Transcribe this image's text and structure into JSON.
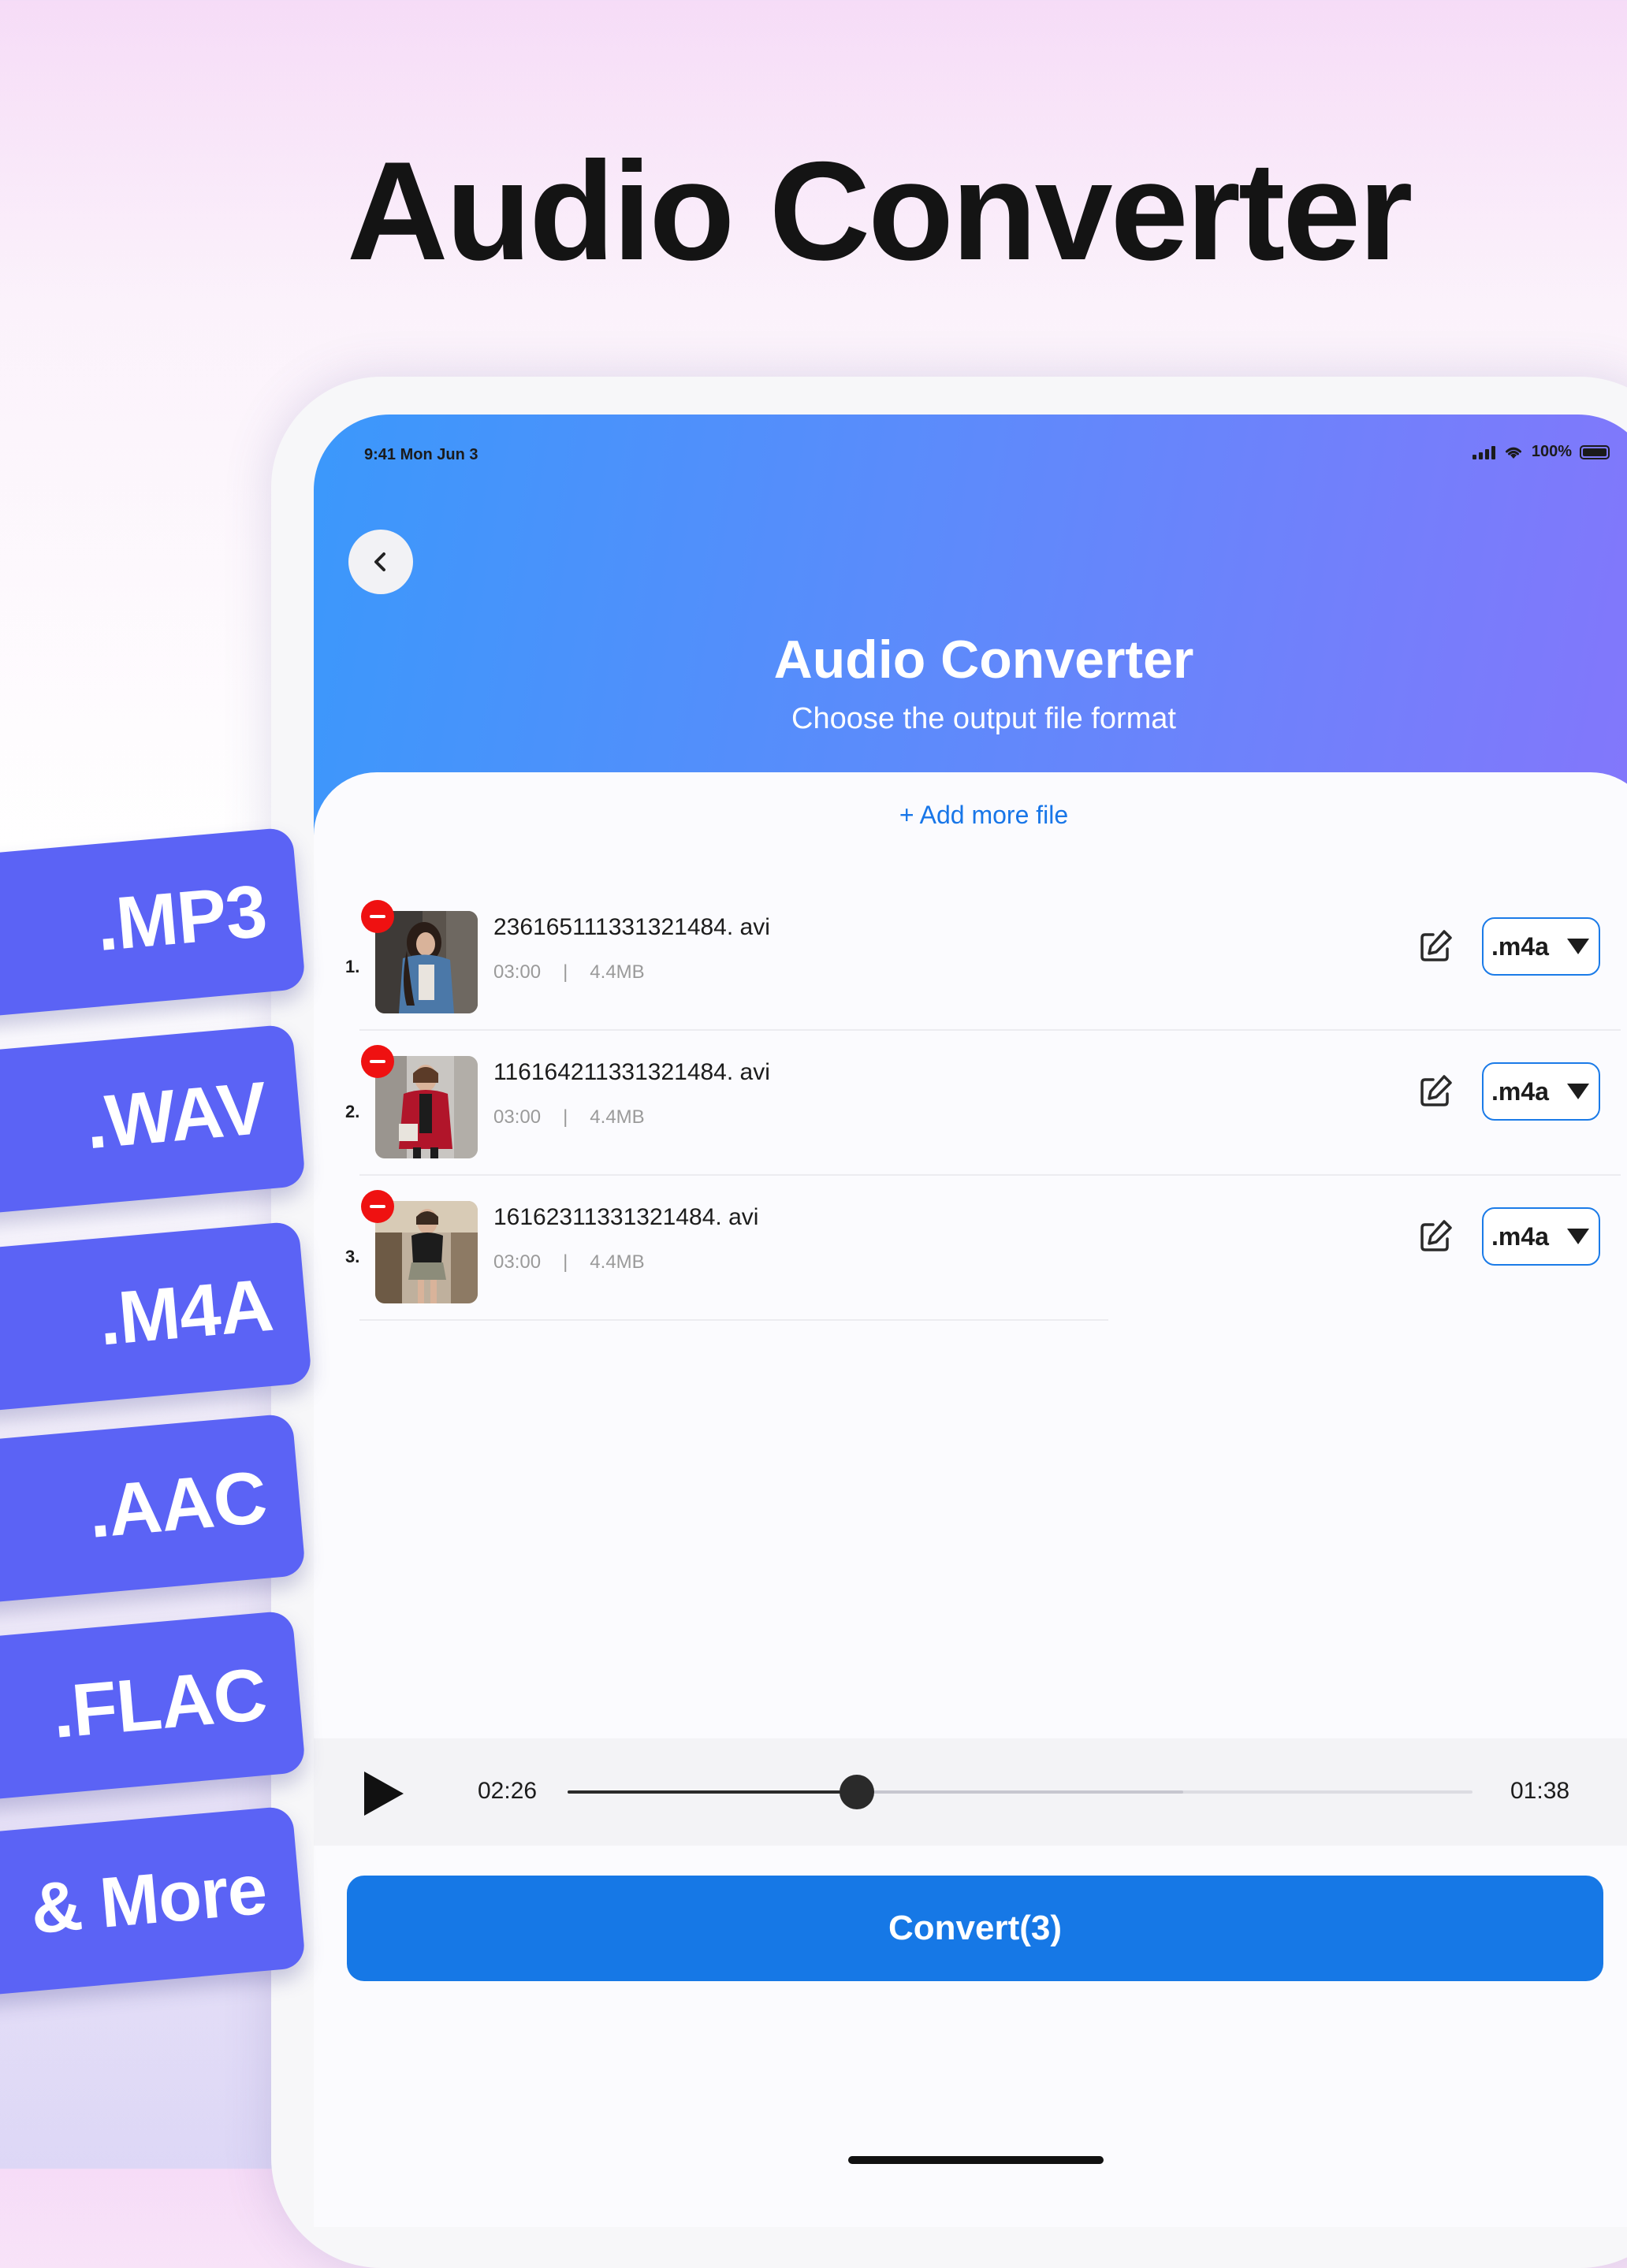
{
  "headline": "Audio Converter",
  "format_tags": [
    ".MP3",
    ".WAV",
    ".M4A",
    ".AAC",
    ".FLAC",
    "& More"
  ],
  "status_bar": {
    "time": "9:41  Mon Jun 3",
    "battery": "100%"
  },
  "header": {
    "title": "Audio Converter",
    "subtitle": "Choose the output file format"
  },
  "add_more_label": "+ Add more file",
  "files": [
    {
      "index": "1.",
      "name": "236165111331321484. avi",
      "duration": "03:00",
      "separator": "|",
      "size": "4.4MB",
      "format": ".m4a"
    },
    {
      "index": "2.",
      "name": "116164211331321484. avi",
      "duration": "03:00",
      "separator": "|",
      "size": "4.4MB",
      "format": ".m4a"
    },
    {
      "index": "3.",
      "name": "16162311331321484. avi",
      "duration": "03:00",
      "separator": "|",
      "size": "4.4MB",
      "format": ".m4a"
    }
  ],
  "player": {
    "elapsed": "02:26",
    "remaining": "01:38",
    "progress": 0.32,
    "buffered": 0.68
  },
  "convert_label": "Convert(3)",
  "colors": {
    "accent": "#1678e6",
    "tag": "#5b63f5",
    "remove": "#ef1111",
    "hero_start": "#3b98fb",
    "hero_end": "#8476fb"
  }
}
